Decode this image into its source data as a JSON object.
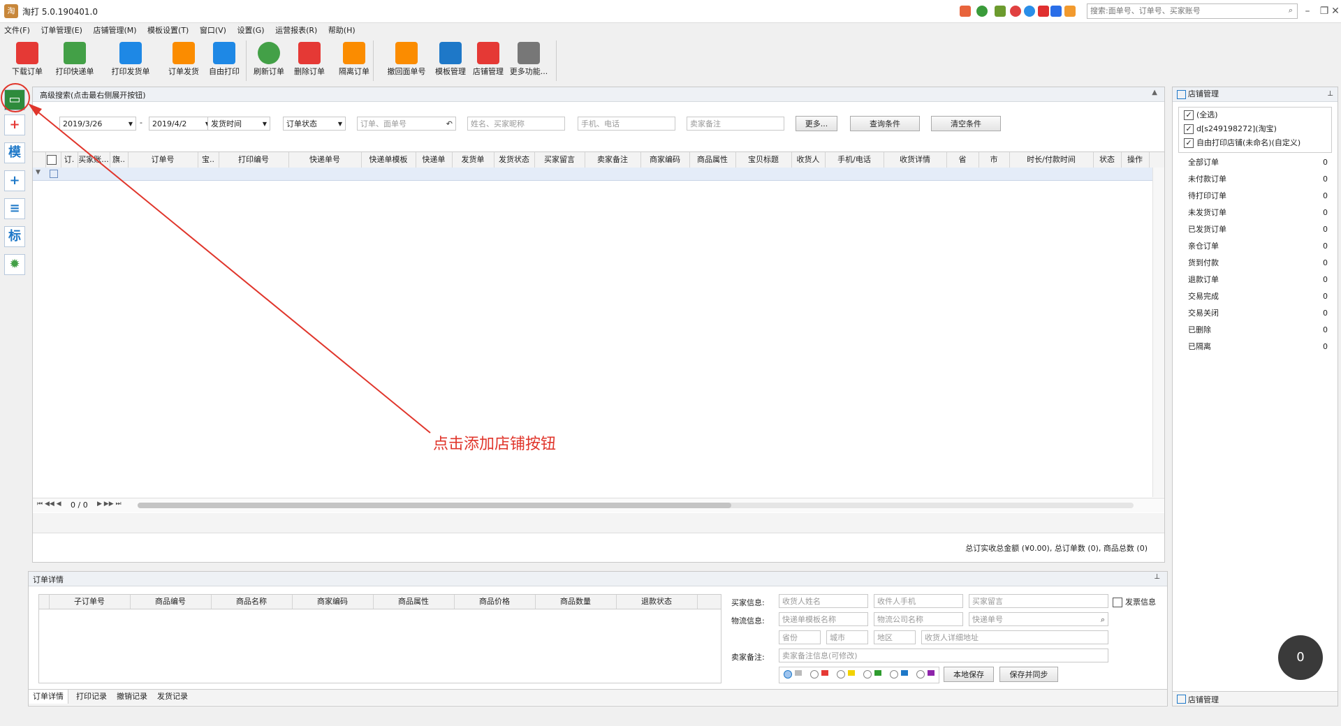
{
  "app": {
    "title": "淘打 5.0.190401.0",
    "logo": "淘"
  },
  "top_search": {
    "placeholder": "搜索:面单号、订单号、买家账号"
  },
  "menu": [
    "文件(F)",
    "订单管理(E)",
    "店铺管理(M)",
    "模板设置(T)",
    "窗口(V)",
    "设置(G)",
    "运营报表(R)",
    "帮助(H)"
  ],
  "toolbar": [
    {
      "label": "下载订单",
      "icon": "download-icon",
      "color": "#e53935"
    },
    {
      "label": "打印快递单",
      "icon": "printer-icon",
      "color": "#43a047"
    },
    {
      "label": "打印发货单",
      "icon": "list-icon",
      "color": "#1e88e5"
    },
    {
      "label": "订单发货",
      "icon": "truck-icon",
      "color": "#fb8c00"
    },
    {
      "label": "自由打印",
      "icon": "paper-plane-icon",
      "color": "#1e88e5"
    },
    {
      "label": "刷新订单",
      "icon": "refresh-icon",
      "color": "#43a047"
    },
    {
      "label": "删除订单",
      "icon": "trash-icon",
      "color": "#e53935"
    },
    {
      "label": "隔离订单",
      "icon": "lock-icon",
      "color": "#fb8c00"
    },
    {
      "label": "撤回面单号",
      "icon": "undo-icon",
      "color": "#fb8c00"
    },
    {
      "label": "模板管理",
      "icon": "template-icon",
      "color": "#1e78c8"
    },
    {
      "label": "店铺管理",
      "icon": "shop-icon",
      "color": "#e53935"
    },
    {
      "label": "更多功能...",
      "icon": "grid-icon",
      "color": "#555555"
    }
  ],
  "sidebar": [
    {
      "name": "add-shop-button",
      "glyph": "▭"
    },
    {
      "name": "add-button",
      "glyph": "+"
    },
    {
      "name": "template-button",
      "glyph": "模"
    },
    {
      "name": "copy-button",
      "glyph": "+"
    },
    {
      "name": "list-button",
      "glyph": "≡"
    },
    {
      "name": "tag-button",
      "glyph": "标"
    },
    {
      "name": "settings-button",
      "glyph": "✹"
    }
  ],
  "search": {
    "header": "高级搜索(点击最右侧展开按钮)",
    "date_from": "2019/3/26",
    "date_to": "2019/4/2",
    "date_type": "发货时间",
    "order_status": "订单状态",
    "order_no_placeholder": "订单、面单号",
    "buyer_placeholder": "姓名、买家昵称",
    "phone_placeholder": "手机、电话",
    "seller_note_placeholder": "卖家备注",
    "more_button": "更多...",
    "query_button": "查询条件",
    "clear_button": "清空条件"
  },
  "grid": {
    "columns": [
      "订.",
      "买家账...",
      "旗..",
      "订单号",
      "宝..",
      "打印编号",
      "快递单号",
      "快递单模板",
      "快递单",
      "发货单",
      "发货状态",
      "买家留言",
      "卖家备注",
      "商家编码",
      "商品属性",
      "宝贝标题",
      "收货人",
      "手机/电话",
      "收货详情",
      "省",
      "市",
      "时长/付款时间",
      "状态",
      "操作"
    ],
    "pager": "0 / 0",
    "summary": "总订实收总金额 (¥0.00), 总订单数 (0), 商品总数 (0)"
  },
  "right_panel": {
    "title": "店铺管理",
    "shops": [
      "(全选)",
      "d[s249198272](淘宝)",
      "自由打印店铺(未命名)(自定义)"
    ],
    "categories": [
      {
        "label": "全部订单",
        "count": "0"
      },
      {
        "label": "未付款订单",
        "count": "0"
      },
      {
        "label": "待打印订单",
        "count": "0"
      },
      {
        "label": "未发货订单",
        "count": "0"
      },
      {
        "label": "已发货订单",
        "count": "0"
      },
      {
        "label": "亲仓订单",
        "count": "0"
      },
      {
        "label": "货到付款",
        "count": "0"
      },
      {
        "label": "退款订单",
        "count": "0"
      },
      {
        "label": "交易完成",
        "count": "0"
      },
      {
        "label": "交易关闭",
        "count": "0"
      },
      {
        "label": "已删除",
        "count": "0"
      },
      {
        "label": "已隔离",
        "count": "0"
      }
    ],
    "bottom_tab": "店铺管理"
  },
  "detail": {
    "title": "订单详情",
    "columns": [
      "子订单号",
      "商品编号",
      "商品名称",
      "商家编码",
      "商品属性",
      "商品价格",
      "商品数量",
      "退款状态"
    ],
    "buyer_label": "买家信息:",
    "logistics_label": "物流信息:",
    "seller_note_label": "卖家备注:",
    "receiver_name_ph": "收货人姓名",
    "receiver_phone_ph": "收件人手机",
    "buyer_msg_ph": "买家留言",
    "invoice_label": "发票信息",
    "template_ph": "快递单模板名称",
    "company_ph": "物流公司名称",
    "tracking_ph": "快递单号",
    "province_ph": "省份",
    "city_ph": "城市",
    "district_ph": "地区",
    "address_ph": "收货人详细地址",
    "note_ph": "卖家备注信息(可修改)",
    "save_local": "本地保存",
    "save_sync": "保存并同步",
    "tabs": [
      "订单详情",
      "打印记录",
      "撤销记录",
      "发货记录"
    ]
  },
  "annotation": {
    "text": "点击添加店铺按钮",
    "color": "#e0352b"
  },
  "counter": {
    "value": "0"
  }
}
